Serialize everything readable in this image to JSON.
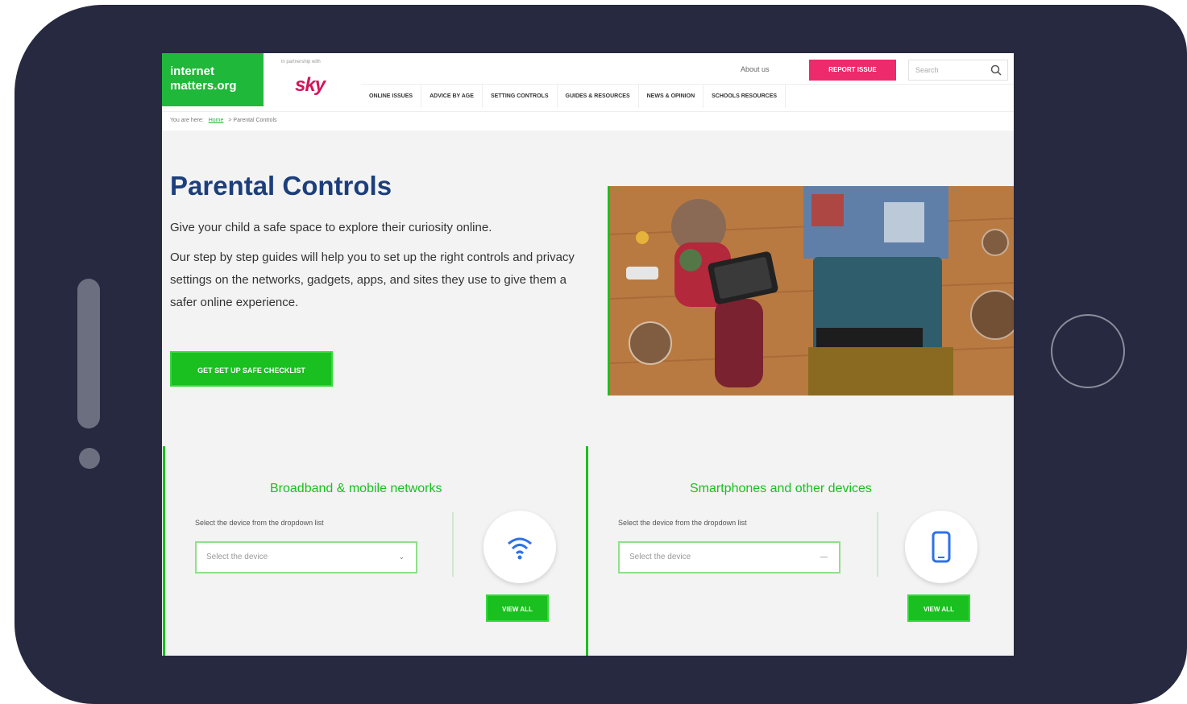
{
  "header": {
    "logo_line1": "internet",
    "logo_line2": "matters.org",
    "powered_by": "in partnership with",
    "sponsor": "sky",
    "about": "About us",
    "report": "REPORT ISSUE",
    "search_placeholder": "Search"
  },
  "nav": {
    "items": [
      {
        "label": "ONLINE ISSUES"
      },
      {
        "label": "ADVICE BY AGE"
      },
      {
        "label": "SETTING CONTROLS"
      },
      {
        "label": "GUIDES & RESOURCES"
      },
      {
        "label": "NEWS & OPINION"
      },
      {
        "label": "SCHOOLS RESOURCES"
      }
    ]
  },
  "breadcrumb": {
    "prefix": "You are here:",
    "home": "Home",
    "current": "Parental Controls"
  },
  "hero": {
    "title": "Parental Controls",
    "subtitle": "Give your child a safe space to explore their curiosity online.",
    "body": "Our step by step guides will help you to set up the right controls and privacy settings on the networks, gadgets, apps, and sites they use to give them a safer online experience.",
    "cta": "GET SET UP SAFE CHECKLIST"
  },
  "cards": {
    "left": {
      "title": "Broadband & mobile networks",
      "label": "Select the device from the dropdown list",
      "select": "Select the device",
      "icon": "wifi-icon",
      "button": "VIEW ALL"
    },
    "right": {
      "title": "Smartphones and other devices",
      "label": "Select the device from the dropdown list",
      "select": "Select the device",
      "icon": "smartphone-icon",
      "button": "VIEW ALL"
    }
  },
  "colors": {
    "frame": "#262940",
    "green": "#19c01f",
    "navy_title": "#1c3f7c",
    "report_pink": "#ed2a6b"
  }
}
